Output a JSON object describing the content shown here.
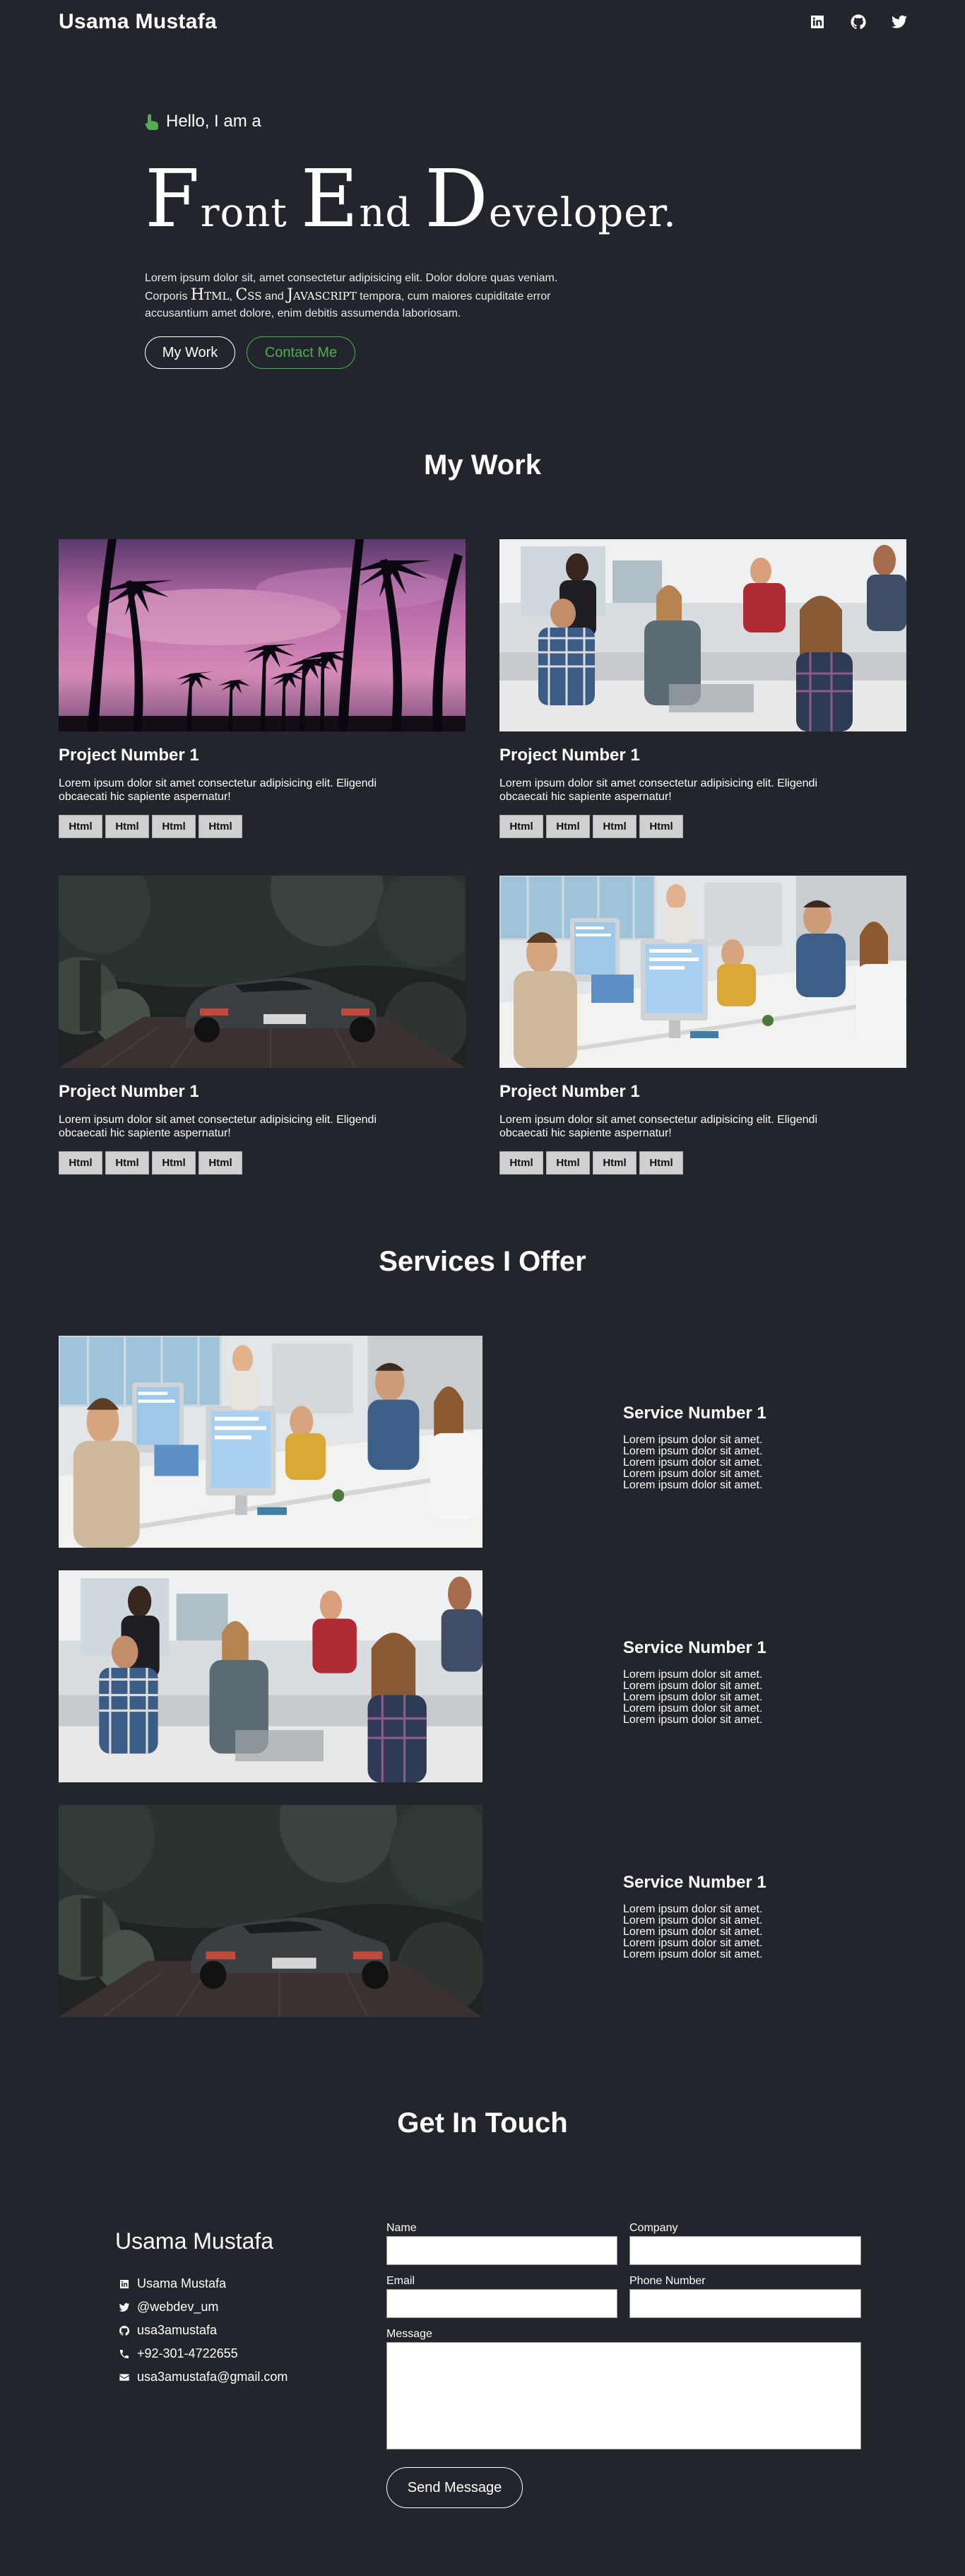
{
  "nav": {
    "brand": "Usama Mustafa",
    "icons": [
      "linkedin-icon",
      "github-icon",
      "twitter-icon"
    ]
  },
  "hero": {
    "greeting": "Hello, I am a",
    "headline": [
      {
        "big": "F",
        "rest": "ront "
      },
      {
        "big": "E",
        "rest": "nd "
      },
      {
        "big": "D",
        "rest": "eveloper."
      }
    ],
    "text_1": "Lorem ipsum dolor sit, amet consectetur adipisicing elit. Dolor dolore quas veniam. Corporis",
    "tech_1": "Html",
    "sep_1": ",",
    "tech_2": "Css",
    "text_2": "and",
    "tech_3": "Javascript",
    "text_3": "tempora, cum maiores cupiditate error accusantium amet dolore, enim debitis assumenda laboriosam.",
    "btn_work": "My Work",
    "btn_contact": "Contact Me"
  },
  "work": {
    "title": "My Work",
    "projects": [
      {
        "title": "Project Number 1",
        "desc": "Lorem ipsum dolor sit amet consectetur adipisicing elit. Eligendi obcaecati hic sapiente aspernatur!",
        "tags": [
          "Html",
          "Html",
          "Html",
          "Html"
        ]
      },
      {
        "title": "Project Number 1",
        "desc": "Lorem ipsum dolor sit amet consectetur adipisicing elit. Eligendi obcaecati hic sapiente aspernatur!",
        "tags": [
          "Html",
          "Html",
          "Html",
          "Html"
        ]
      },
      {
        "title": "Project Number 1",
        "desc": "Lorem ipsum dolor sit amet consectetur adipisicing elit. Eligendi obcaecati hic sapiente aspernatur!",
        "tags": [
          "Html",
          "Html",
          "Html",
          "Html"
        ]
      },
      {
        "title": "Project Number 1",
        "desc": "Lorem ipsum dolor sit amet consectetur adipisicing elit. Eligendi obcaecati hic sapiente aspernatur!",
        "tags": [
          "Html",
          "Html",
          "Html",
          "Html"
        ]
      }
    ]
  },
  "services": {
    "title": "Services I Offer",
    "items": [
      {
        "title": "Service Number 1",
        "desc": "Lorem ipsum dolor sit amet.\nLorem ipsum dolor sit amet.\nLorem ipsum dolor sit amet.\nLorem ipsum dolor sit amet.\nLorem ipsum dolor sit amet."
      },
      {
        "title": "Service Number 1",
        "desc": "Lorem ipsum dolor sit amet.\nLorem ipsum dolor sit amet.\nLorem ipsum dolor sit amet.\nLorem ipsum dolor sit amet.\nLorem ipsum dolor sit amet."
      },
      {
        "title": "Service Number 1",
        "desc": "Lorem ipsum dolor sit amet.\nLorem ipsum dolor sit amet.\nLorem ipsum dolor sit amet.\nLorem ipsum dolor sit amet.\nLorem ipsum dolor sit amet."
      }
    ]
  },
  "contact": {
    "title": "Get In Touch",
    "name": "Usama Mustafa",
    "items": [
      {
        "icon": "linkedin-icon",
        "text": "Usama Mustafa"
      },
      {
        "icon": "twitter-icon",
        "text": "@webdev_um"
      },
      {
        "icon": "github-icon",
        "text": "usa3amustafa"
      },
      {
        "icon": "phone-icon",
        "text": "+92-301-4722655"
      },
      {
        "icon": "envelope-icon",
        "text": "usa3amustafa@gmail.com"
      }
    ],
    "form": {
      "name_label": "Name",
      "company_label": "Company",
      "email_label": "Email",
      "phone_label": "Phone Number",
      "message_label": "Message",
      "send_label": "Send Message"
    }
  },
  "colors": {
    "background": "#22252b",
    "accent_green": "#4caf50",
    "tag_bg": "#d0d0d0"
  }
}
